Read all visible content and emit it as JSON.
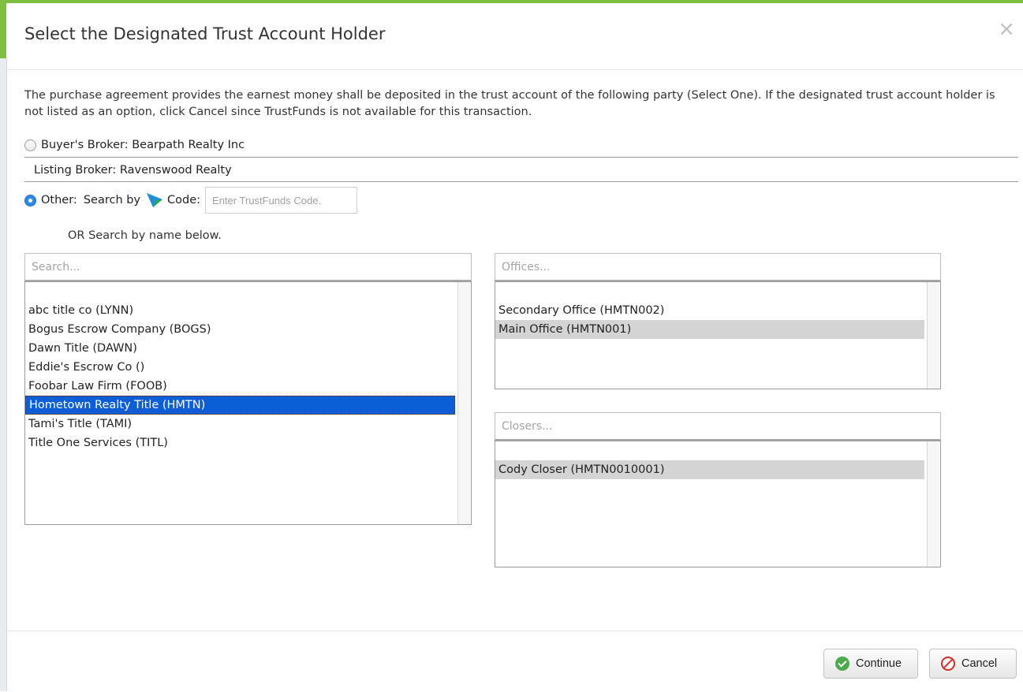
{
  "dialog": {
    "title": "Select the Designated Trust Account Holder",
    "close_label": "×",
    "intro": "The purchase agreement provides the earnest money shall be deposited in the trust account of the following party (Select One). If the designated trust account holder is not listed as an option, click Cancel since TrustFunds is not available for this transaction."
  },
  "options": {
    "buyers_broker": {
      "label": "Buyer's Broker: Bearpath Realty Inc",
      "selected": false
    },
    "listing_broker": {
      "label": "Listing Broker: Ravenswood Realty"
    },
    "other": {
      "label": "Other:",
      "search_by": "Search by",
      "code_label": "Code:",
      "code_placeholder": "Enter TrustFunds Code.",
      "selected": true
    },
    "or_text": "OR Search by name below."
  },
  "companies": {
    "placeholder": "Search...",
    "items": [
      "abc title co (LYNN)",
      "Bogus Escrow Company (BOGS)",
      "Dawn Title (DAWN)",
      "Eddie's Escrow Co ()",
      "Foobar Law Firm (FOOB)",
      "Hometown Realty Title (HMTN)",
      "Tami's Title (TAMI)",
      "Title One Services (TITL)"
    ],
    "selected": "Hometown Realty Title (HMTN)"
  },
  "offices": {
    "placeholder": "Offices...",
    "items": [
      "Secondary Office (HMTN002)",
      "Main Office (HMTN001)"
    ],
    "selected": "Main Office (HMTN001)"
  },
  "closers": {
    "placeholder": "Closers...",
    "items": [
      "Cody Closer (HMTN0010001)"
    ],
    "selected": "Cody Closer (HMTN0010001)"
  },
  "footer": {
    "continue_label": "Continue",
    "cancel_label": "Cancel"
  },
  "colors": {
    "accent_green": "#7fbf3f",
    "selection_blue": "#0a5fd6",
    "radio_blue": "#2b8ae8",
    "selection_gray": "#d4d4d4"
  }
}
